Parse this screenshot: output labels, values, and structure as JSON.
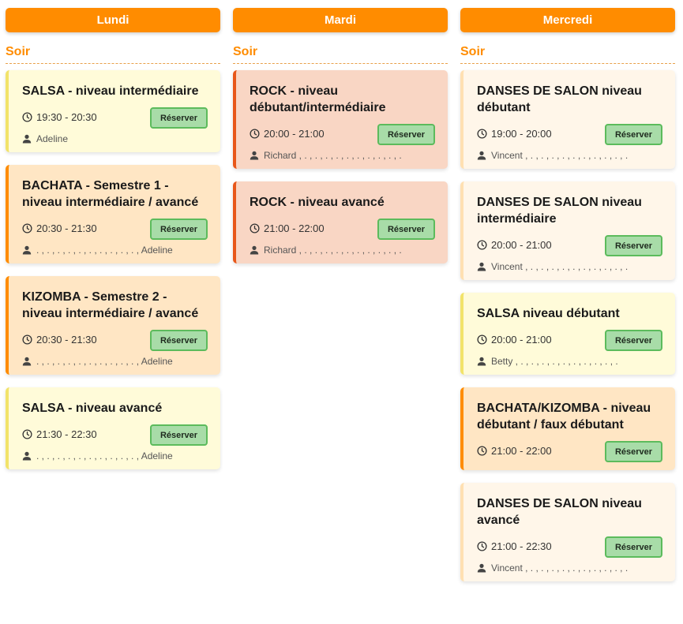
{
  "columns": [
    {
      "day": "Lundi",
      "section": "Soir",
      "cards": [
        {
          "title": "SALSA - niveau intermédiaire",
          "time": "19:30 - 20:30",
          "teachers": "Adeline",
          "button": "Réserver",
          "color": "yellow"
        },
        {
          "title": "BACHATA - Semestre 1 - niveau intermédiaire / avancé",
          "time": "20:30 - 21:30",
          "teachers": ". , . , . , . , . , . , . , . , . , . , Adeline",
          "button": "Réserver",
          "color": "orange"
        },
        {
          "title": "KIZOMBA - Semestre 2 - niveau intermédiaire / avancé",
          "time": "20:30 - 21:30",
          "teachers": ". , . , . , . , . , . , . , . , . , . , Adeline",
          "button": "Réserver",
          "color": "orange"
        },
        {
          "title": "SALSA - niveau avancé",
          "time": "21:30 - 22:30",
          "teachers": ". , . , . , . , . , . , . , . , . , . , Adeline",
          "button": "Réserver",
          "color": "yellow"
        }
      ]
    },
    {
      "day": "Mardi",
      "section": "Soir",
      "cards": [
        {
          "title": "ROCK - niveau débutant/intermédiaire",
          "time": "20:00 - 21:00",
          "teachers": "Richard , . , . , . , . , . , . , . , . , . , .",
          "button": "Réserver",
          "color": "red"
        },
        {
          "title": "ROCK - niveau avancé",
          "time": "21:00 - 22:00",
          "teachers": "Richard , . , . , . , . , . , . , . , . , . , .",
          "button": "Réserver",
          "color": "red"
        }
      ]
    },
    {
      "day": "Mercredi",
      "section": "Soir",
      "cards": [
        {
          "title": "DANSES DE SALON niveau débutant",
          "time": "19:00 - 20:00",
          "teachers": "Vincent , . , . , . , . , . , . , . , . , . , .",
          "button": "Réserver",
          "color": "cream"
        },
        {
          "title": "DANSES DE SALON niveau intermédiaire",
          "time": "20:00 - 21:00",
          "teachers": "Vincent , . , . , . , . , . , . , . , . , . , .",
          "button": "Réserver",
          "color": "cream"
        },
        {
          "title": "SALSA niveau débutant",
          "time": "20:00 - 21:00",
          "teachers": "Betty , . , . , . , . , . , . , . , . , . , .",
          "button": "Réserver",
          "color": "yellow"
        },
        {
          "title": "BACHATA/KIZOMBA - niveau débutant / faux débutant",
          "time": "21:00 - 22:00",
          "teachers": "",
          "button": "Réserver",
          "color": "orange"
        },
        {
          "title": "DANSES DE SALON niveau avancé",
          "time": "21:00 - 22:30",
          "teachers": "Vincent , . , . , . , . , . , . , . , . , . , .",
          "button": "Réserver",
          "color": "cream"
        }
      ]
    }
  ],
  "colors": {
    "accent": "#ff8c00",
    "yellow_card": "#fffbd9",
    "orange_card": "#ffe6c4",
    "red_card": "#f9d6c4",
    "cream_card": "#fff6e9",
    "button_bg": "#a8dca8",
    "button_border": "#5cbb5c"
  },
  "icons": {
    "time": "clock-icon",
    "teacher": "person-icon"
  }
}
